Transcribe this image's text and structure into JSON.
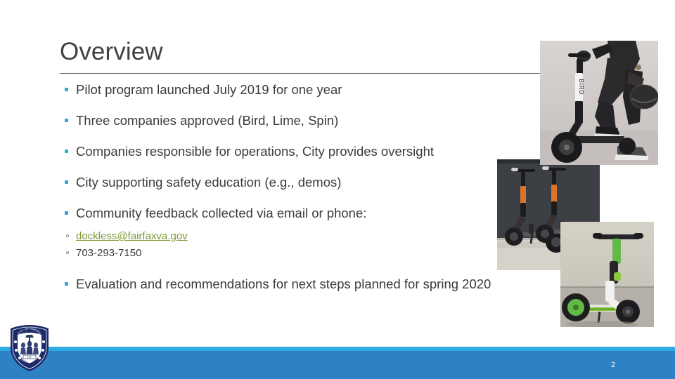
{
  "slide": {
    "title": "Overview",
    "page_number": "2",
    "accent_bullet_color": "#2fa6d4",
    "footer_stripe_color": "#2eabe2",
    "footer_band_color": "#2d81c4",
    "link_color": "#7e9a36",
    "title_color": "#414141",
    "body_text_color": "#3b3b3b"
  },
  "bullets": [
    {
      "text": "Pilot program launched July 2019 for one year"
    },
    {
      "text": "Three companies approved (Bird, Lime, Spin)"
    },
    {
      "text": "Companies responsible for operations, City provides oversight"
    },
    {
      "text": "City supporting safety education (e.g., demos)"
    },
    {
      "text": "Community feedback collected via email or phone:"
    },
    {
      "text": "Evaluation and recommendations for next steps planned for spring 2020"
    }
  ],
  "sub_bullets": [
    {
      "text": "dockless@fairfaxva.gov",
      "is_link": true
    },
    {
      "text": "703-293-7150",
      "is_link": false
    }
  ],
  "photos": [
    {
      "name": "bird-scooter-rider-photo",
      "alt": "Person in black clothing holding a helmet stepping onto a black Bird scooter"
    },
    {
      "name": "spin-scooters-photo",
      "alt": "Two orange and black Spin scooters parked on a curb beside dark asphalt"
    },
    {
      "name": "lime-scooter-photo",
      "alt": "Green and white Lime scooter standing on a concrete sidewalk"
    }
  ],
  "logo": {
    "name": "city-of-fairfax-seal",
    "alt": "City of Fairfax circular seal with coat of arms",
    "ring_color": "#1b2a6b",
    "field_color": "#ffffff"
  }
}
